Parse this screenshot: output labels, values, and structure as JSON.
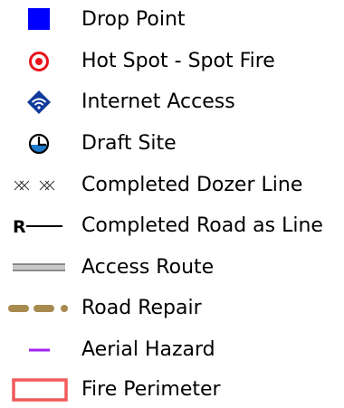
{
  "legend": {
    "items": [
      {
        "label": "Drop Point",
        "icon": "blue-square-icon",
        "color": "#0000ff"
      },
      {
        "label": "Hot Spot - Spot Fire",
        "icon": "target-circle-icon",
        "color": "#e8141c"
      },
      {
        "label": "Internet Access",
        "icon": "wifi-diamond-icon",
        "color": "#103a9c"
      },
      {
        "label": "Draft Site",
        "icon": "draft-site-circle-icon",
        "color": "#1f7bd0"
      },
      {
        "label": "Completed Dozer Line",
        "icon": "dozer-line-icon",
        "color": "#333333"
      },
      {
        "label": "Completed Road as Line",
        "icon": "road-line-icon",
        "symbol_text": "R",
        "color": "#000000"
      },
      {
        "label": "Access Route",
        "icon": "access-route-icon",
        "color": "#888888"
      },
      {
        "label": "Road Repair",
        "icon": "road-repair-icon",
        "color": "#a88a4e"
      },
      {
        "label": "Aerial Hazard",
        "icon": "aerial-hazard-icon",
        "color": "#a020f0"
      },
      {
        "label": "Fire Perimeter",
        "icon": "fire-perimeter-icon",
        "color": "#f05a5a"
      }
    ]
  }
}
